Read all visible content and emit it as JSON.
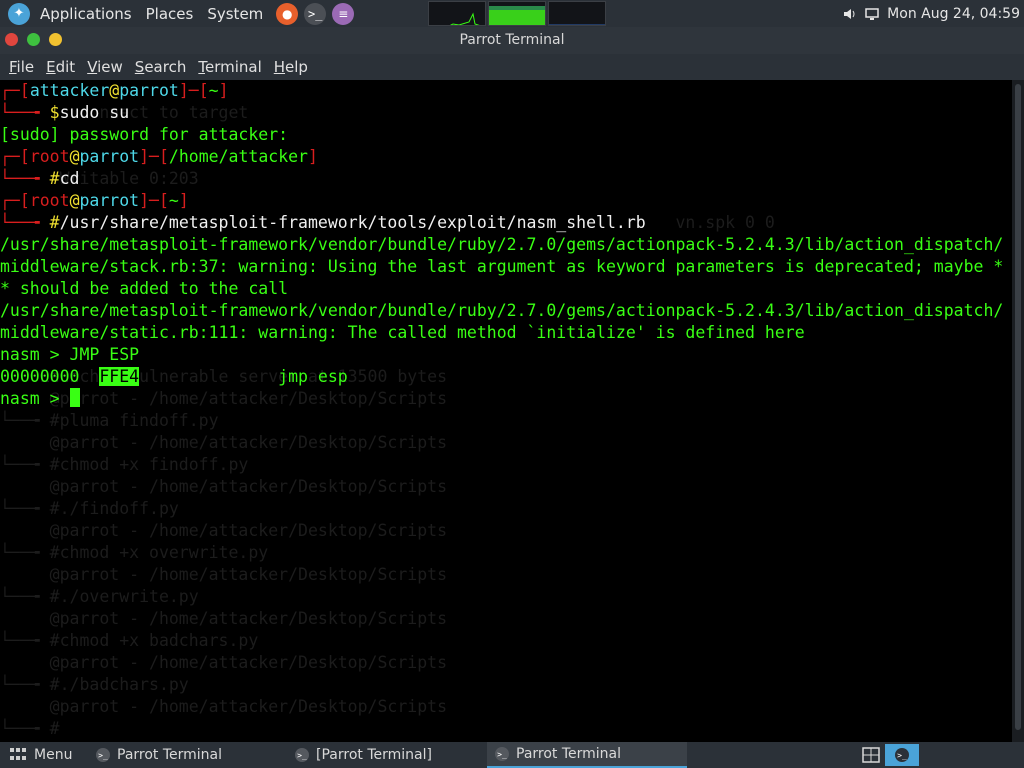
{
  "top_panel": {
    "menus": [
      "Applications",
      "Places",
      "System"
    ],
    "clock": "Mon Aug 24, 04:59",
    "firefox_icon": "firefox-icon",
    "terminal_icon": "terminal-icon",
    "notes_icon": "text-editor-icon"
  },
  "window": {
    "title": "Parrot Terminal",
    "menu": [
      "File",
      "Edit",
      "View",
      "Search",
      "Terminal",
      "Help"
    ]
  },
  "terminal": {
    "lines": [
      {
        "segments": [
          {
            "t": "┌─[",
            "c": "red"
          },
          {
            "t": "attacker",
            "c": "cyan"
          },
          {
            "t": "@",
            "c": "yel"
          },
          {
            "t": "parrot",
            "c": "cyan"
          },
          {
            "t": "]─[",
            "c": "red"
          },
          {
            "t": "~",
            "c": "grn"
          },
          {
            "t": "]",
            "c": "red"
          }
        ]
      },
      {
        "segments": [
          {
            "t": "└──╼ ",
            "c": "red"
          },
          {
            "t": "$",
            "c": "yel"
          },
          {
            "t": "sudo su",
            "c": "wht"
          }
        ]
      },
      {
        "segments": [
          {
            "t": "[sudo] password for attacker:",
            "c": "grn"
          }
        ]
      },
      {
        "segments": [
          {
            "t": "┌─[",
            "c": "red"
          },
          {
            "t": "root",
            "c": "red"
          },
          {
            "t": "@",
            "c": "yel"
          },
          {
            "t": "parrot",
            "c": "cyan"
          },
          {
            "t": "]─[",
            "c": "red"
          },
          {
            "t": "/home/attacker",
            "c": "grn"
          },
          {
            "t": "]",
            "c": "red"
          }
        ]
      },
      {
        "segments": [
          {
            "t": "└──╼ ",
            "c": "red"
          },
          {
            "t": "#",
            "c": "yel"
          },
          {
            "t": "cd",
            "c": "wht"
          }
        ]
      },
      {
        "segments": [
          {
            "t": "┌─[",
            "c": "red"
          },
          {
            "t": "root",
            "c": "red"
          },
          {
            "t": "@",
            "c": "yel"
          },
          {
            "t": "parrot",
            "c": "cyan"
          },
          {
            "t": "]─[",
            "c": "red"
          },
          {
            "t": "~",
            "c": "grn"
          },
          {
            "t": "]",
            "c": "red"
          }
        ]
      },
      {
        "segments": [
          {
            "t": "└──╼ ",
            "c": "red"
          },
          {
            "t": "#",
            "c": "yel"
          },
          {
            "t": "/usr/share/metasploit-framework/tools/exploit/nasm_shell.rb",
            "c": "wht"
          }
        ]
      },
      {
        "segments": [
          {
            "t": "/usr/share/metasploit-framework/vendor/bundle/ruby/2.7.0/gems/actionpack-5.2.4.3/lib/action_dispatch/",
            "c": "grn"
          }
        ]
      },
      {
        "segments": [
          {
            "t": "middleware/stack.rb:37: warning: Using the last argument as keyword parameters is deprecated; maybe *",
            "c": "grn"
          }
        ]
      },
      {
        "segments": [
          {
            "t": "* should be added to the call",
            "c": "grn"
          }
        ]
      },
      {
        "segments": [
          {
            "t": "/usr/share/metasploit-framework/vendor/bundle/ruby/2.7.0/gems/actionpack-5.2.4.3/lib/action_dispatch/",
            "c": "grn"
          }
        ]
      },
      {
        "segments": [
          {
            "t": "middleware/static.rb:111: warning: The called method `initialize' is defined here",
            "c": "grn"
          }
        ]
      },
      {
        "segments": [
          {
            "t": "nasm > JMP ESP",
            "c": "grn"
          }
        ]
      },
      {
        "segments": [
          {
            "t": "00000000  ",
            "c": "grn"
          },
          {
            "t": "FFE4",
            "c": "hl"
          },
          {
            "t": "              ",
            "c": "grn"
          },
          {
            "t": "jmp esp",
            "c": "grn"
          }
        ]
      },
      {
        "segments": [
          {
            "t": "nasm > ",
            "c": "grn"
          }
        ],
        "cursor": true
      }
    ],
    "ghost_lines": [
      "",
      "        connect to target",
      "",
      "",
      "      Writable 0:203",
      "",
      "                                                                    vn.spk 0 0",
      "",
      "",
      "",
      "",
      "",
      "",
      "    Launched vulnerable server at 13500 bytes",
      "     @parrot - /home/attacker/Desktop/Scripts",
      "└──╼ #pluma findoff.py",
      "     @parrot - /home/attacker/Desktop/Scripts",
      "└──╼ #chmod +x findoff.py",
      "     @parrot - /home/attacker/Desktop/Scripts",
      "└──╼ #./findoff.py",
      "     @parrot - /home/attacker/Desktop/Scripts",
      "└──╼ #chmod +x overwrite.py",
      "     @parrot - /home/attacker/Desktop/Scripts",
      "└──╼ #./overwrite.py",
      "     @parrot - /home/attacker/Desktop/Scripts",
      "└──╼ #chmod +x badchars.py",
      "     @parrot - /home/attacker/Desktop/Scripts",
      "└──╼ #./badchars.py",
      "     @parrot - /home/attacker/Desktop/Scripts",
      "└──╼ #"
    ]
  },
  "bottom_panel": {
    "menu_label": "Menu",
    "tasks": [
      {
        "label": "Parrot Terminal",
        "active": false
      },
      {
        "label": "[Parrot Terminal]",
        "active": false
      },
      {
        "label": "Parrot Terminal",
        "active": true
      }
    ]
  },
  "colors": {
    "terminal_green": "#39ff14",
    "prompt_red": "#d81e1e",
    "host_cyan": "#4ed8e8",
    "panel_bg": "#2b3138",
    "accent_blue": "#4aa3d8"
  }
}
